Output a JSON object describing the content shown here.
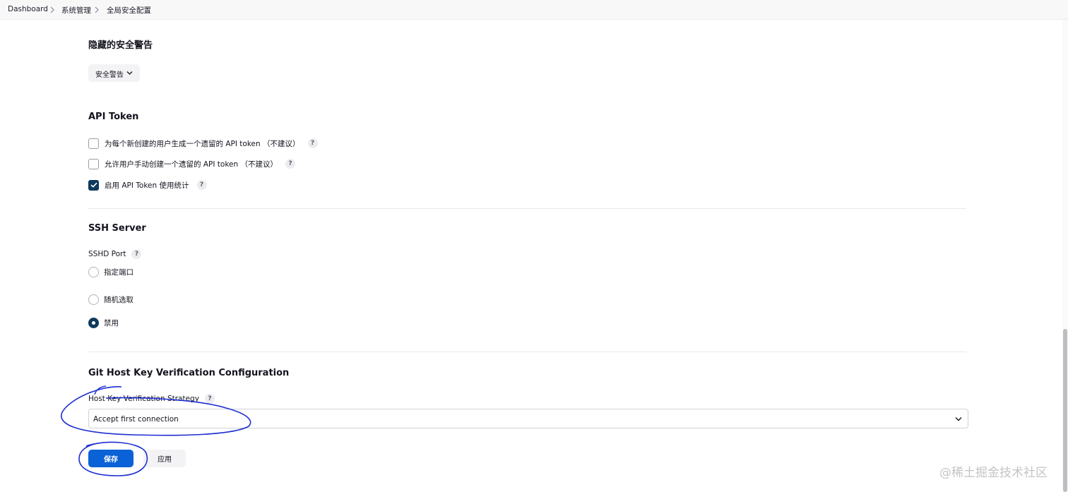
{
  "breadcrumb": {
    "items": [
      "Dashboard",
      "系统管理",
      "全局安全配置"
    ]
  },
  "hidden_warnings": {
    "title": "隐藏的安全警告",
    "dropdown_label": "安全警告"
  },
  "api_token": {
    "title": "API Token",
    "options": [
      {
        "label": "为每个新创建的用户生成一个遗留的 API token （不建议）",
        "checked": false,
        "help": "?"
      },
      {
        "label": "允许用户手动创建一个遗留的 API token （不建议）",
        "checked": false,
        "help": "?"
      },
      {
        "label": "启用 API Token 使用统计",
        "checked": true,
        "help": "?"
      }
    ]
  },
  "ssh_server": {
    "title": "SSH Server",
    "port_label": "SSHD Port",
    "port_help": "?",
    "options": [
      {
        "label": "指定端口",
        "selected": false
      },
      {
        "label": "随机选取",
        "selected": false
      },
      {
        "label": "禁用",
        "selected": true
      }
    ]
  },
  "git_host_key": {
    "title": "Git Host Key Verification Configuration",
    "strategy_label": "Host Key Verification Strategy",
    "strategy_help": "?",
    "strategy_value": "Accept first connection"
  },
  "actions": {
    "save_label": "保存",
    "apply_label": "应用"
  },
  "watermark": "@稀土掘金技术社区",
  "colors": {
    "primary_button": "#0b62d6",
    "checked_control": "#0f3a5c",
    "annotation_ink": "#1d2fd0"
  }
}
